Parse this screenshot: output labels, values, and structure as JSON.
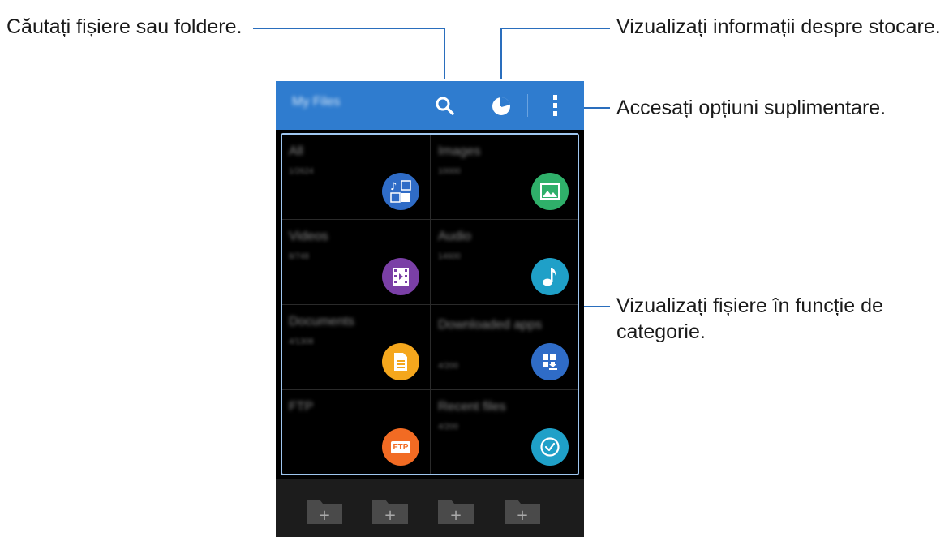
{
  "callouts": {
    "search": "Căutați fișiere sau foldere.",
    "storage": "Vizualizați informații despre stocare.",
    "more": "Accesați opțiuni suplimentare.",
    "category_line1": "Vizualizați fișiere în funcție de",
    "category_line2": "categorie."
  },
  "appbar": {
    "title": "My Files",
    "icons": [
      "search-icon",
      "storage-pie-icon",
      "more-options-icon"
    ]
  },
  "categories": [
    {
      "name": "All",
      "count": "1/2624",
      "icon": "all-files-icon",
      "color": "#2f6cc7"
    },
    {
      "name": "Images",
      "count": "10000",
      "icon": "image-icon",
      "color": "#2fb06a"
    },
    {
      "name": "Videos",
      "count": "8/748",
      "icon": "video-icon",
      "color": "#7a3fa6"
    },
    {
      "name": "Audio",
      "count": "14600",
      "icon": "music-note-icon",
      "color": "#1fa0c8"
    },
    {
      "name": "Documents",
      "count": "4/1308",
      "icon": "document-icon",
      "color": "#f5a71d"
    },
    {
      "name": "Downloaded apps",
      "count": "4/200",
      "icon": "download-app-icon",
      "color": "#2f6cc7"
    },
    {
      "name": "FTP",
      "count": "",
      "icon": "ftp-icon",
      "color": "#f26b23"
    },
    {
      "name": "Recent files",
      "count": "4/200",
      "icon": "clock-icon",
      "color": "#1fa0c8"
    }
  ],
  "ftp_badge": "FTP",
  "bottombar": {
    "folders": [
      "add-folder-icon",
      "add-folder-icon",
      "add-folder-icon",
      "add-folder-icon"
    ],
    "plus": "+"
  }
}
